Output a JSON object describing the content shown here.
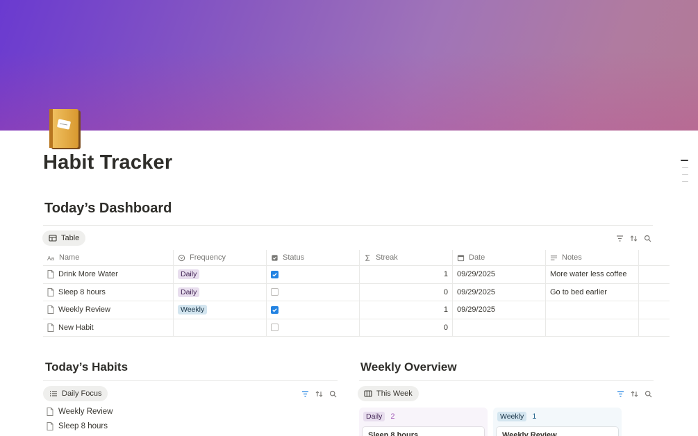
{
  "page": {
    "title": "Habit Tracker",
    "icon": "ledger-book-icon"
  },
  "dashboard": {
    "heading": "Today’s Dashboard",
    "view_label": "Table",
    "columns": [
      {
        "label": "Name",
        "icon": "text-icon"
      },
      {
        "label": "Frequency",
        "icon": "select-icon"
      },
      {
        "label": "Status",
        "icon": "checkbox-icon"
      },
      {
        "label": "Streak",
        "icon": "sigma-icon"
      },
      {
        "label": "Date",
        "icon": "calendar-icon"
      },
      {
        "label": "Notes",
        "icon": "lines-icon"
      }
    ],
    "rows": [
      {
        "name": "Drink More Water",
        "frequency": "Daily",
        "status": true,
        "streak": "1",
        "date": "09/29/2025",
        "notes": "More water less coffee"
      },
      {
        "name": "Sleep 8 hours",
        "frequency": "Daily",
        "status": false,
        "streak": "0",
        "date": "09/29/2025",
        "notes": "Go to bed earlier"
      },
      {
        "name": "Weekly Review",
        "frequency": "Weekly",
        "status": true,
        "streak": "1",
        "date": "09/29/2025",
        "notes": ""
      },
      {
        "name": "New Habit",
        "frequency": "",
        "status": false,
        "streak": "0",
        "date": "",
        "notes": ""
      }
    ]
  },
  "habits": {
    "heading": "Today’s Habits",
    "view_label": "Daily Focus",
    "items": [
      "Weekly Review",
      "Sleep 8 hours"
    ]
  },
  "weekly": {
    "heading": "Weekly Overview",
    "view_label": "This Week",
    "groups": [
      {
        "label": "Daily",
        "count": "2",
        "card": "Sleep 8 hours"
      },
      {
        "label": "Weekly",
        "count": "1",
        "card": "Weekly Review"
      }
    ]
  },
  "colors": {
    "accent_blue": "#2383e2",
    "daily_tag": "#e8deee",
    "weekly_tag": "#d3e5ef"
  }
}
